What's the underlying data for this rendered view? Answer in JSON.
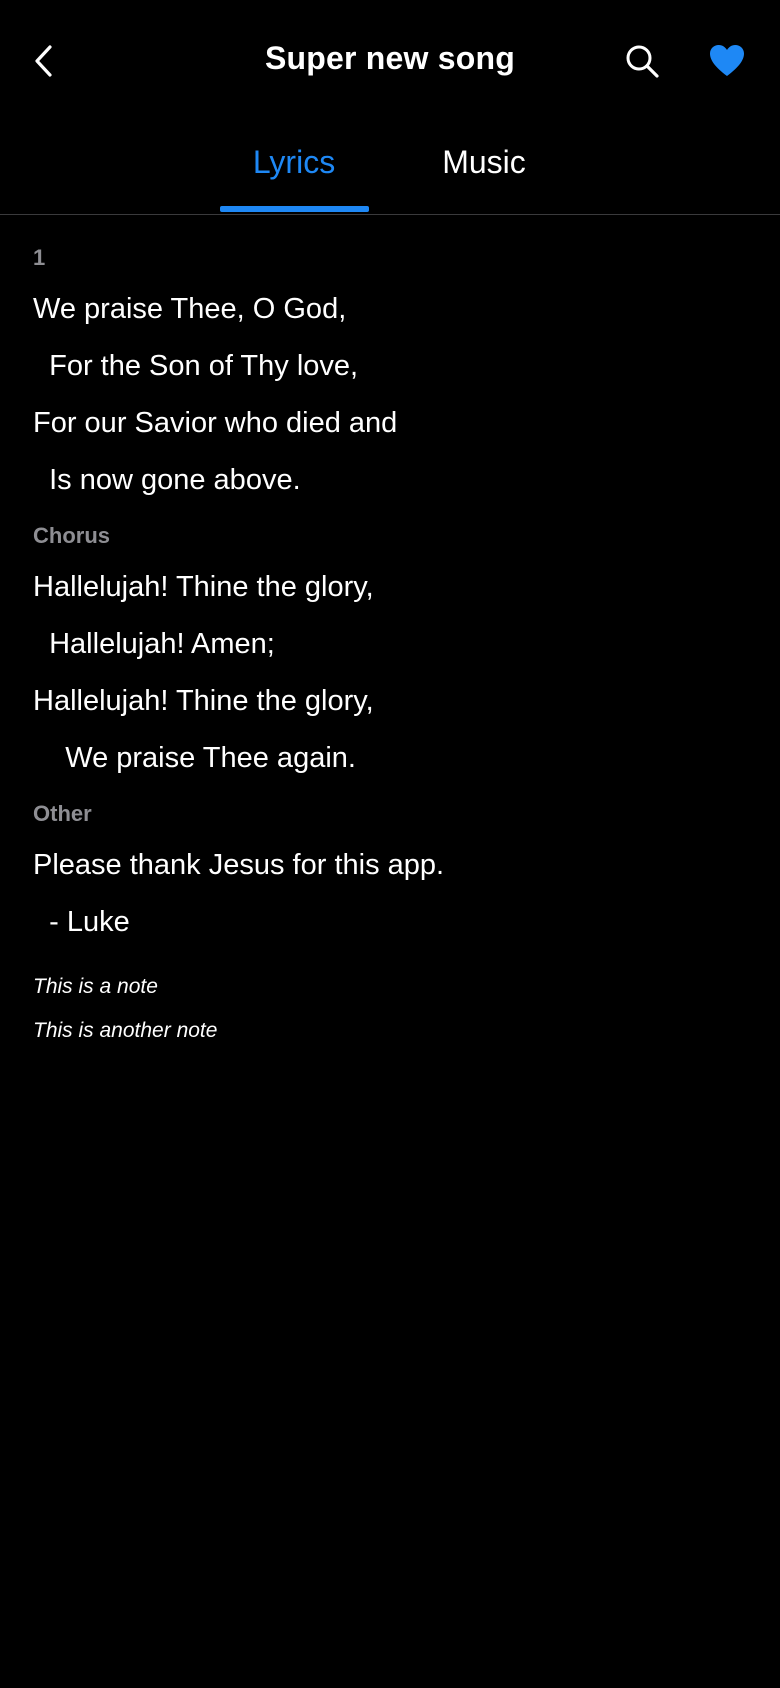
{
  "header": {
    "title": "Super new song",
    "back_icon": "chevron-left-icon",
    "search_icon": "search-icon",
    "favorite_icon": "heart-icon",
    "accent_color": "#1e88f5"
  },
  "tabs": [
    {
      "label": "Lyrics",
      "active": true
    },
    {
      "label": "Music",
      "active": false
    }
  ],
  "stanzas": [
    {
      "label": "1",
      "lines": [
        "We praise Thee, O God,",
        "  For the Son of Thy love,",
        "For our Savior who died and",
        "  Is now gone above."
      ]
    },
    {
      "label": "Chorus",
      "lines": [
        "Hallelujah! Thine the glory,",
        "  Hallelujah! Amen;",
        "Hallelujah! Thine the glory,",
        "    We praise Thee again."
      ]
    },
    {
      "label": "Other",
      "lines": [
        "Please thank Jesus for this app.",
        "  - Luke"
      ]
    }
  ],
  "notes": [
    "This is a note",
    "This is another note"
  ]
}
